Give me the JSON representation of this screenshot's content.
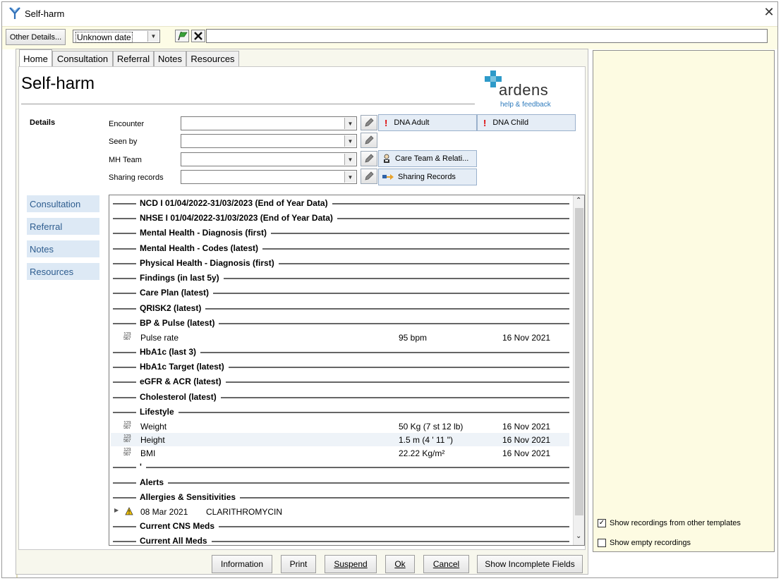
{
  "window": {
    "title": "Self-harm"
  },
  "toolbar": {
    "other_details_label": "Other Details...",
    "date_value": "Unknown date",
    "free_text_value": ""
  },
  "tabs": [
    {
      "label": "Home"
    },
    {
      "label": "Consultation"
    },
    {
      "label": "Referral"
    },
    {
      "label": "Notes"
    },
    {
      "label": "Resources"
    }
  ],
  "page": {
    "title": "Self-harm",
    "logo_text": "ardens",
    "help_link": "help & feedback"
  },
  "details": {
    "section_label": "Details",
    "fields": [
      {
        "label": "Encounter",
        "value": ""
      },
      {
        "label": "Seen by",
        "value": ""
      },
      {
        "label": "MH Team",
        "value": ""
      },
      {
        "label": "Sharing records",
        "value": ""
      }
    ],
    "quick_buttons": {
      "dna_adult": "DNA Adult",
      "dna_child": "DNA Child",
      "care_team": "Care Team & Relati...",
      "sharing_records": "Sharing Records"
    }
  },
  "side_nav": [
    {
      "label": "Consultation"
    },
    {
      "label": "Referral"
    },
    {
      "label": "Notes"
    },
    {
      "label": "Resources"
    }
  ],
  "list": {
    "s1": "NCD I 01/04/2022-31/03/2023 (End of Year Data)",
    "s2": "NHSE I 01/04/2022-31/03/2023 (End of Year Data)",
    "s3": "Mental Health - Diagnosis (first)",
    "s4": "Mental Health - Codes (latest)",
    "s5": "Physical Health - Diagnosis (first)",
    "s6": "Findings (in last 5y)",
    "s7": "Care Plan (latest)",
    "s8": "QRISK2 (latest)",
    "s9": "BP & Pulse (latest)",
    "r_pulse": {
      "name": "Pulse rate",
      "value": "95 bpm",
      "date": "16 Nov 2021"
    },
    "s10": "HbA1c (last 3)",
    "s11": "HbA1c Target (latest)",
    "s12": "eGFR & ACR (latest)",
    "s13": "Cholesterol (latest)",
    "s14": "Lifestyle",
    "r_weight": {
      "name": "Weight",
      "value": "50 Kg (7 st 12 lb)",
      "date": "16 Nov 2021"
    },
    "r_height": {
      "name": "Height",
      "value": "1.5 m (4 ' 11 \")",
      "date": "16 Nov 2021"
    },
    "r_bmi": {
      "name": "BMI",
      "value": "22.22 Kg/m²",
      "date": "16 Nov 2021"
    },
    "s15": "'",
    "s16": "Alerts",
    "s17": "Allergies & Sensitivities",
    "allergy": {
      "date": "08 Mar 2021",
      "name": "CLARITHROMYCIN"
    },
    "s18": "Current CNS Meds",
    "s19": "Current All Meds"
  },
  "right_panel": {
    "show_other_templates": "Show recordings from other templates",
    "show_empty": "Show empty recordings"
  },
  "buttons": {
    "information": "Information",
    "print": "Print",
    "suspend": "Suspend",
    "ok": "Ok",
    "cancel": "Cancel",
    "show_incomplete": "Show Incomplete Fields"
  }
}
